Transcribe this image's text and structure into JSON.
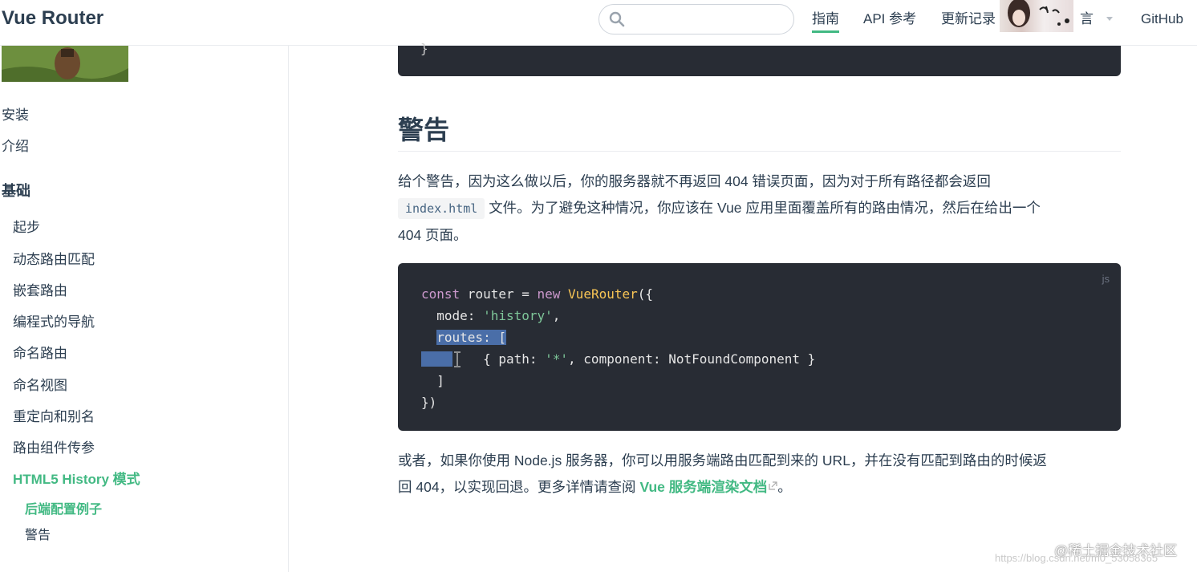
{
  "navbar": {
    "title": "Vue Router",
    "search": {
      "value": "",
      "placeholder": ""
    },
    "links": [
      {
        "label": "指南",
        "active": true
      },
      {
        "label": "API 参考",
        "active": false
      },
      {
        "label": "更新记录",
        "active": false
      },
      {
        "label": "言",
        "active": false
      },
      {
        "label": "GitHub",
        "active": false
      }
    ],
    "accent_color": "#42b983"
  },
  "sidebar": {
    "items": [
      {
        "label": "安装"
      },
      {
        "label": "介绍"
      }
    ],
    "group_title": "基础",
    "group_items": [
      {
        "label": "起步"
      },
      {
        "label": "动态路由匹配"
      },
      {
        "label": "嵌套路由"
      },
      {
        "label": "编程式的导航"
      },
      {
        "label": "命名路由"
      },
      {
        "label": "命名视图"
      },
      {
        "label": "重定向和别名"
      },
      {
        "label": "路由组件传参"
      },
      {
        "label": "HTML5 History 模式"
      }
    ],
    "sub_items": [
      {
        "label": "后端配置例子"
      },
      {
        "label": "警告"
      }
    ]
  },
  "main": {
    "top_code_brace": "}",
    "section_title": "警告",
    "para1_a": "给个警告，因为这么做以后，你的服务器就不再返回 404 错误页面，因为对于所有路径都会返回",
    "para1_code": "index.html",
    "para1_b": "文件。为了避免这种情况，你应该在 Vue 应用里面覆盖所有的路由情况，然后在给出一个",
    "para1_c": "404 页面。",
    "code_lang": "js",
    "code": {
      "l1_kw": "const",
      "l1_var": " router = ",
      "l1_new": "new",
      "l1_sp": " ",
      "l1_fn": "VueRouter",
      "l1_end": "({",
      "l2_key": "  mode: ",
      "l2_str": "'history'",
      "l2_end": ",",
      "l3_sel": "routes: [",
      "l4_a": "    { path: ",
      "l4_str": "'*'",
      "l4_b": ", component: NotFoundComponent }",
      "l5": "  ]",
      "l6": "})"
    },
    "para2_a": "或者，如果你使用 Node.js 服务器，你可以用服务端路由匹配到来的 URL，并在没有匹配到路由的时候返",
    "para2_b": "回 404，以实现回退。更多详情请查阅",
    "para2_link": "Vue 服务端渲染文档",
    "para2_end": "。"
  },
  "watermark": {
    "text": "@稀土掘金技术社区",
    "url": "https://blog.csdn.net/m0_53058365"
  }
}
